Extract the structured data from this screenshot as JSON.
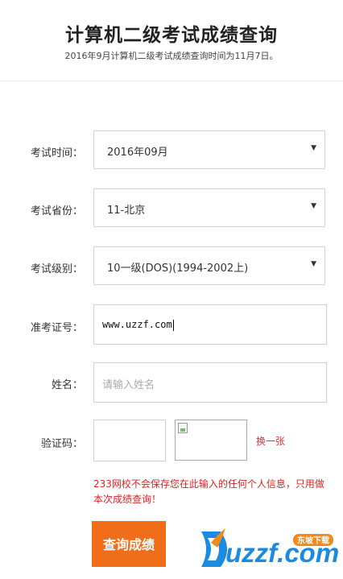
{
  "header": {
    "title": "计算机二级考试成绩查询",
    "subtitle": "2016年9月计算机二级考试成绩查询时间为11月7日。"
  },
  "form": {
    "exam_time": {
      "label": "考试时间：",
      "value": "2016年09月"
    },
    "province": {
      "label": "考试省份：",
      "value": "11-北京"
    },
    "level": {
      "label": "考试级别：",
      "value": "10一级(DOS)(1994-2002上)"
    },
    "ticket": {
      "label": "准考证号：",
      "value": "www.uzzf.com"
    },
    "name": {
      "label": "姓名：",
      "placeholder": "请输入姓名"
    },
    "captcha": {
      "label": "验证码：",
      "refresh": "换一张"
    },
    "notice": "233网校不会保存您在此输入的任何个人信息，只用做本次成绩查询！",
    "submit": "查询成绩"
  },
  "watermark": {
    "brand": "uzzf.com",
    "tag": "东坡下载"
  },
  "colors": {
    "accent": "#f06d1a",
    "notice": "#d22222",
    "logo_blue": "#1a8be0",
    "logo_orange": "#f08a1c"
  }
}
